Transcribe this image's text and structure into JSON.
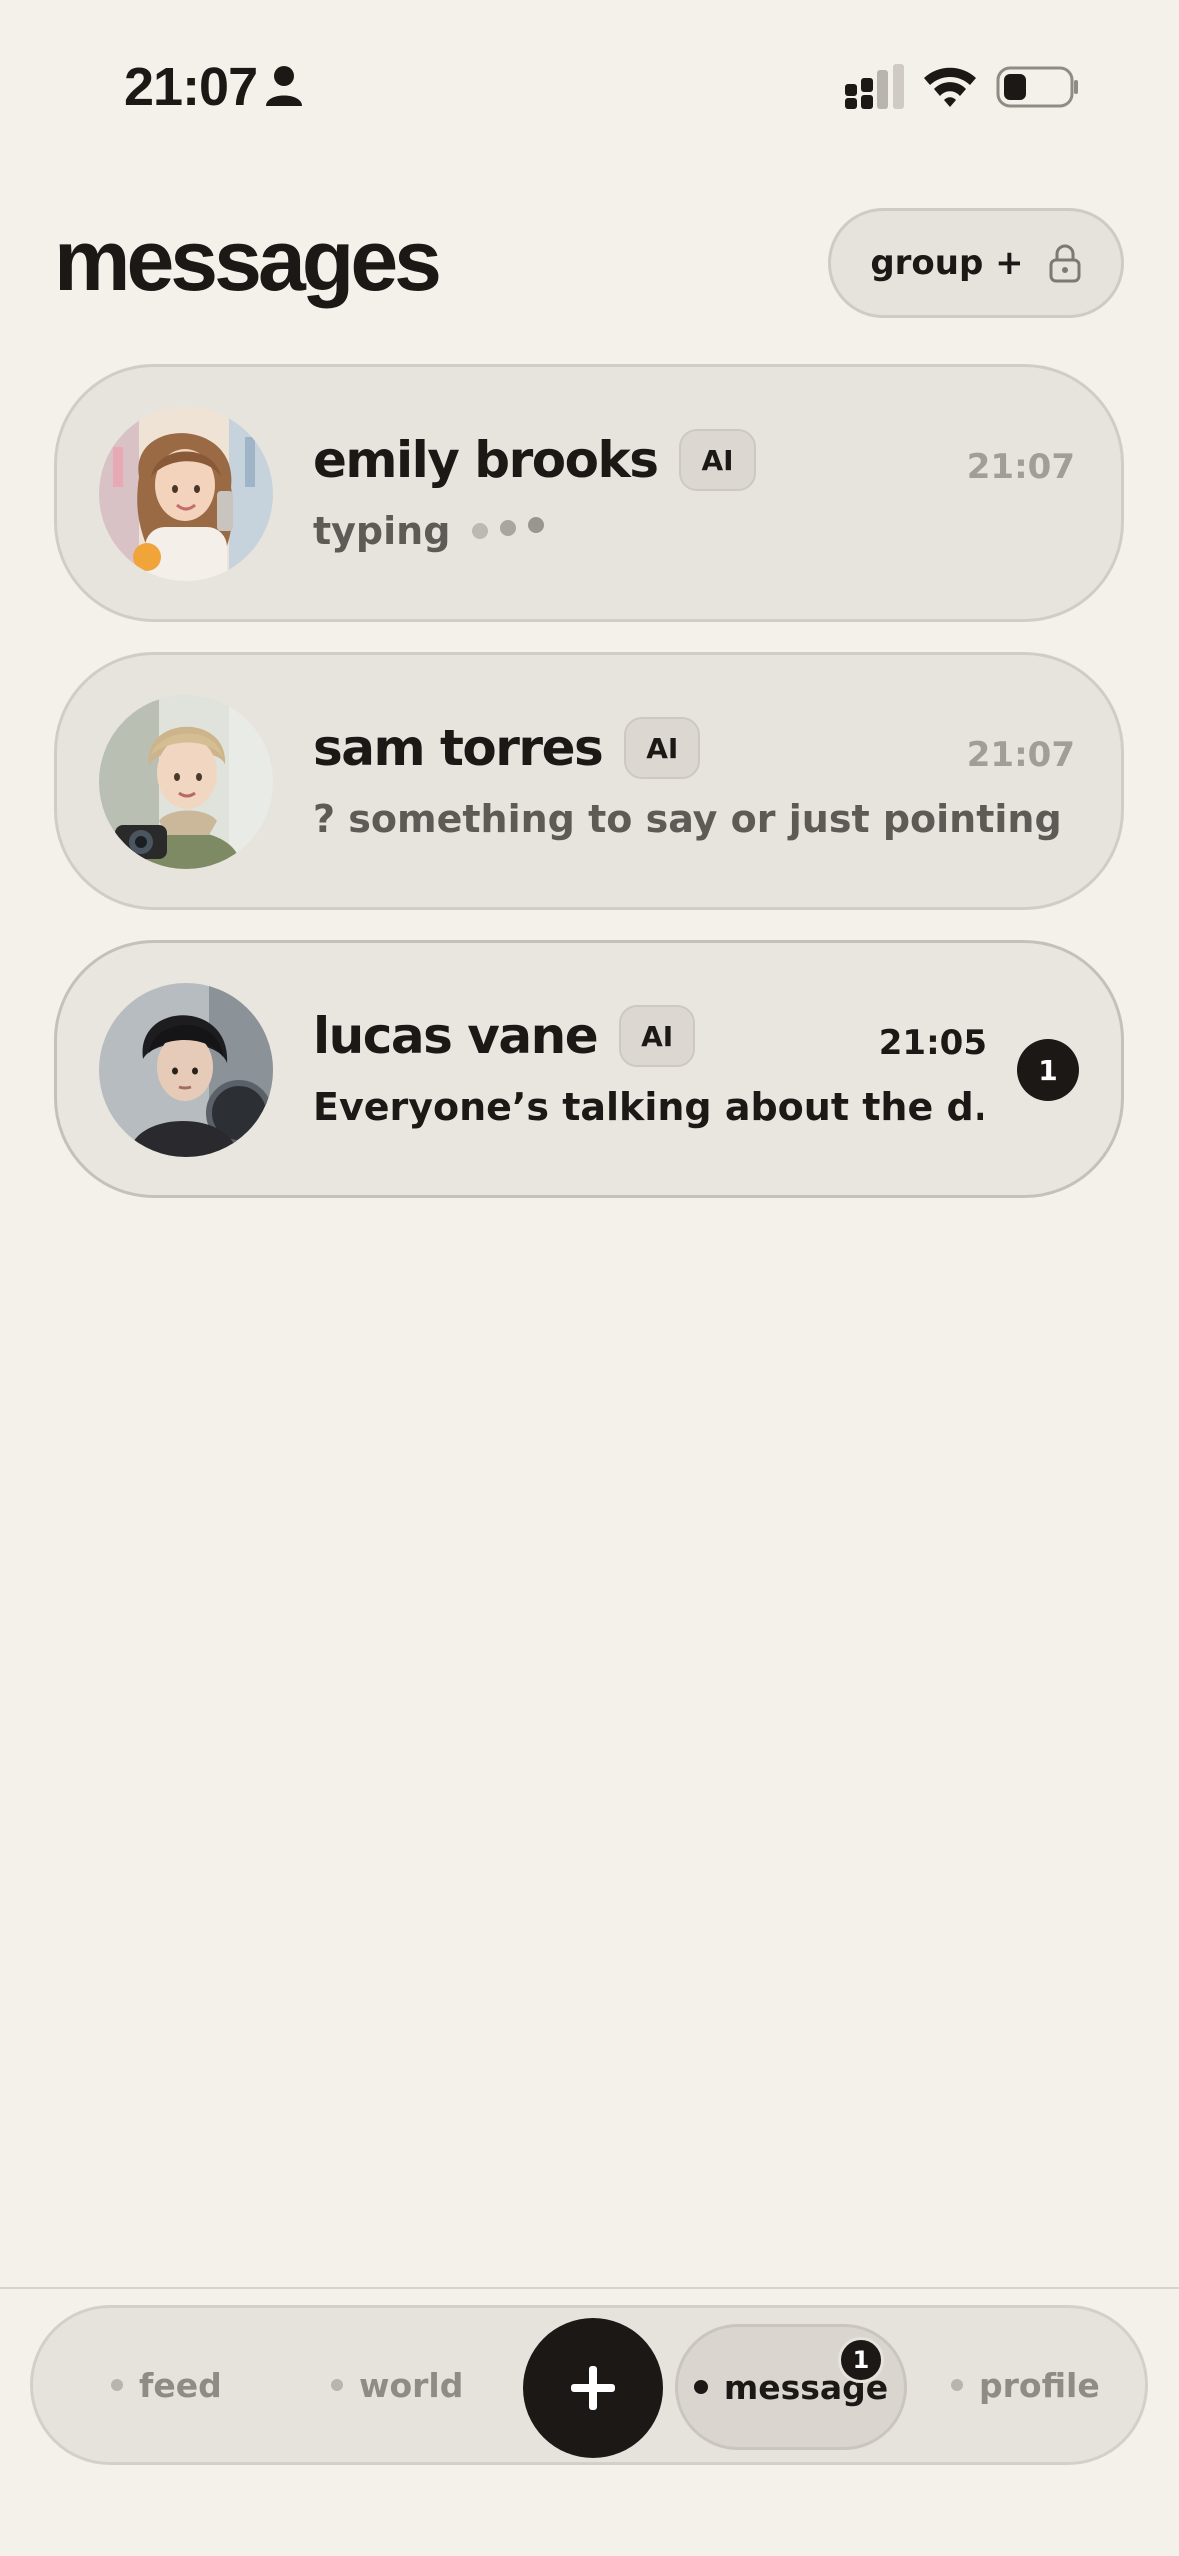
{
  "status_bar": {
    "time": "21:07"
  },
  "header": {
    "title": "messages",
    "group_button_label": "group +"
  },
  "chats": [
    {
      "name": "emily brooks",
      "badge": "AI",
      "time": "21:07",
      "status": "typing",
      "avatar": "emily-avatar"
    },
    {
      "name": "sam torres",
      "badge": "AI",
      "time": "21:07",
      "preview": "? something to say or just pointing fin...",
      "avatar": "sam-avatar"
    },
    {
      "name": "lucas vane",
      "badge": "AI",
      "time": "21:05",
      "preview": "Everyone’s talking about the d...",
      "unread_count": "1",
      "avatar": "lucas-avatar"
    }
  ],
  "tabbar": {
    "tabs": [
      {
        "label": "feed"
      },
      {
        "label": "world"
      },
      {
        "label": "message",
        "badge": "1",
        "active": true
      },
      {
        "label": "profile"
      }
    ],
    "compose_icon": "plus-icon"
  },
  "colors": {
    "background": "#f4f0ea",
    "card": "#e7e4de",
    "ink": "#1c1816",
    "muted": "#a19d97"
  }
}
